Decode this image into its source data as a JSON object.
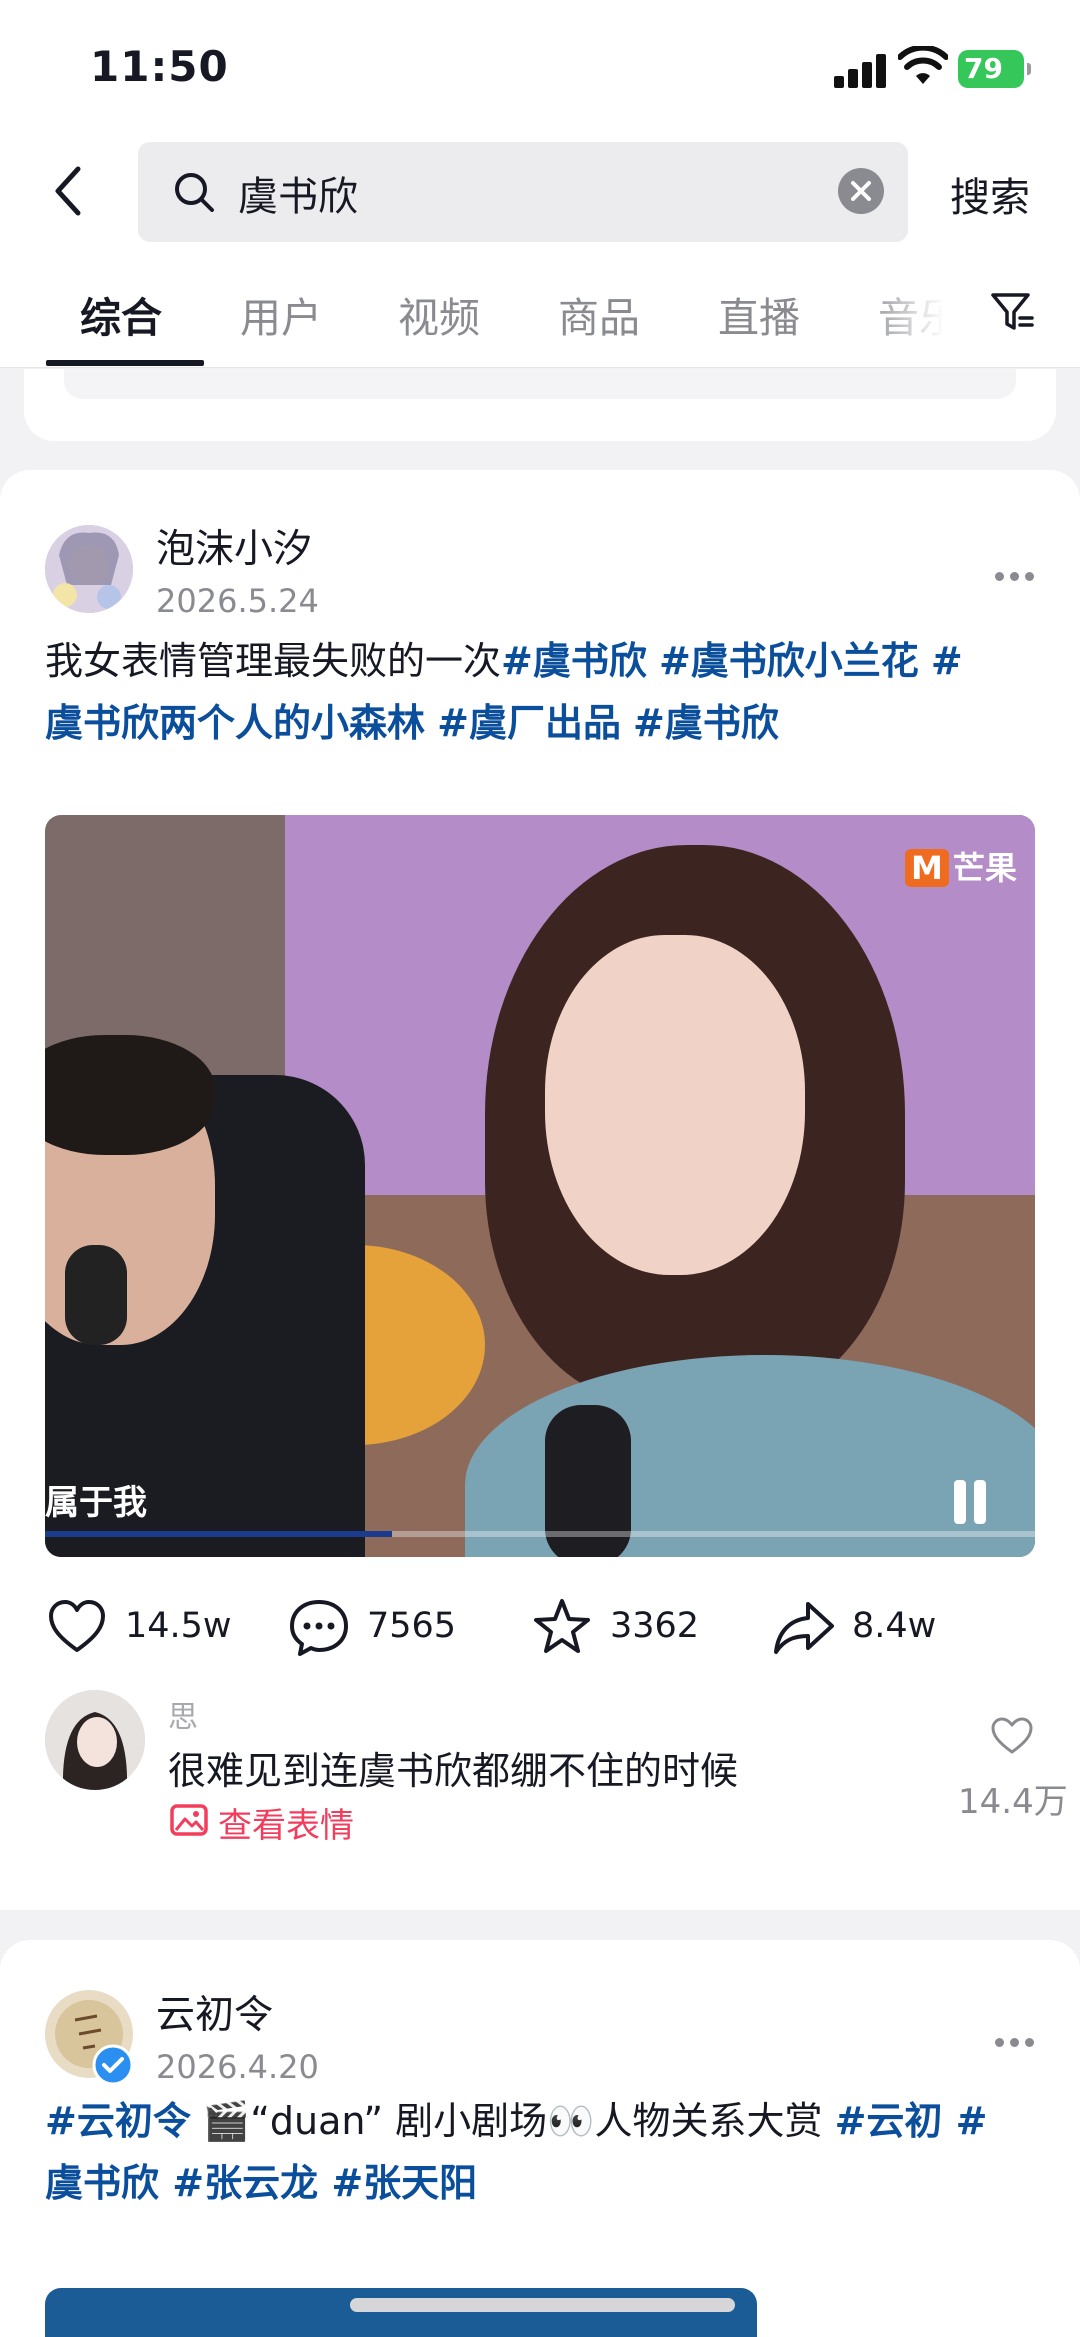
{
  "status_bar": {
    "time": "11:50",
    "battery": "79"
  },
  "search": {
    "query": "虞书欣",
    "button": "搜索"
  },
  "tabs": [
    {
      "label": "综合",
      "active": true
    },
    {
      "label": "用户"
    },
    {
      "label": "视频"
    },
    {
      "label": "商品"
    },
    {
      "label": "直播"
    },
    {
      "label": "音乐"
    }
  ],
  "post1": {
    "author": "泡沫小汐",
    "date": "2026.5.24",
    "caption_text": "我女表情管理最失败的一次",
    "tags": [
      "#虞书欣",
      "#虞书欣小兰花",
      "#",
      "虞书欣两个人的小森林",
      "#虞厂出品",
      "#虞书欣"
    ],
    "video": {
      "logo": "芒果",
      "subtitle": "属于我",
      "progress": 0.35
    },
    "stats": {
      "likes": "14.5w",
      "comments": "7565",
      "favorites": "3362",
      "shares": "8.4w"
    },
    "top_comment": {
      "user": "思",
      "text": "很难见到连虞书欣都绷不住的时候",
      "link": "查看表情",
      "likes": "14.4万"
    }
  },
  "post2": {
    "author": "云初令",
    "date": "2026.4.20",
    "caption_line1": [
      "#云初令",
      " 🎬“duan” 剧小剧场👀人物关系大赏 ",
      "#云初",
      " #"
    ],
    "caption_line2": [
      "虞书欣",
      " #张云龙",
      " #张天阳"
    ]
  },
  "colors": {
    "tag": "#0b4f9c",
    "accent": "#f23e5c",
    "battery": "#35c759"
  }
}
